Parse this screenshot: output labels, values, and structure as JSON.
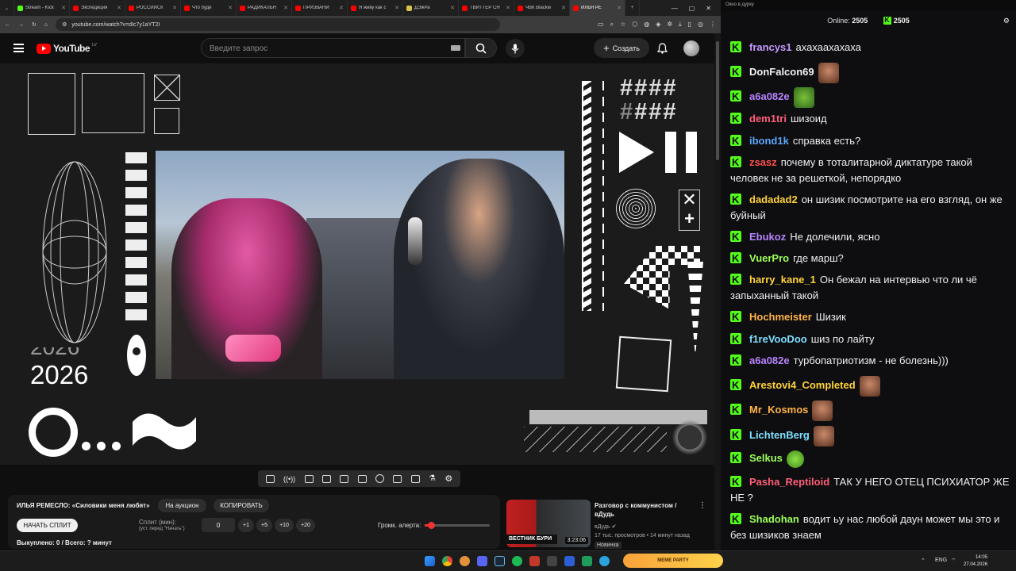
{
  "browser": {
    "tabs": [
      {
        "label": "Stream - Kick",
        "color": "#53fc18"
      },
      {
        "label": "Экспедиция",
        "color": "#ff0000"
      },
      {
        "label": "РОССИЙСК",
        "color": "#ff0000"
      },
      {
        "label": "Что буде",
        "color": "#ff0000"
      },
      {
        "label": "РАДИКАЛЬН",
        "color": "#ff0000"
      },
      {
        "label": "ПРИЗВАНИ",
        "color": "#ff0000"
      },
      {
        "label": "Я живу как с",
        "color": "#ff0000"
      },
      {
        "label": "ДЭжРа",
        "color": "#d8c24a"
      },
      {
        "label": "ТВИТТЕР СН",
        "color": "#ff0000"
      },
      {
        "label": "ЧВК Blackw",
        "color": "#ff0000"
      },
      {
        "label": "ИЛЬЯ РЕ",
        "color": "#ff0000",
        "active": true
      }
    ],
    "url": "youtube.com/watch?v=dIc7y1aYT2I"
  },
  "youtube": {
    "logo_text": "YouTube",
    "region": "LV",
    "search_placeholder": "Введите запрос",
    "create_label": "Создать"
  },
  "video": {
    "overlay_numbers": [
      "2026",
      "2026"
    ]
  },
  "panel": {
    "title": "ИЛЬЯ РЕМЕСЛО: «Силовики меня любят»",
    "auction_label": "На аукцион",
    "copy_label": "КОПИРОВАТЬ",
    "start_split_label": "НАЧАТЬ СПЛИТ",
    "split_label": "Сплит (мин):",
    "split_hint": "(уст. перед \"Начать\")",
    "split_value": "0",
    "steps": [
      "+1",
      "+5",
      "+10",
      "+20"
    ],
    "volume_label": "Громк. алерта:",
    "volume_fraction": 0.1,
    "footer": "Выкуплено: 0 / Всего: ? минут"
  },
  "recommended": {
    "title": "Разговор с коммунистом / вДудь",
    "channel": "вДудь",
    "meta": "17 тыс. просмотров • 14 минут назад",
    "badge": "Новинка",
    "duration": "3:23:06",
    "thumb_text": "ВЕСТНИК БУРИ"
  },
  "chat": {
    "window_title": "Окно в дурку",
    "online_label": "Online:",
    "online_count": "2505",
    "kick_count": "2505",
    "messages": [
      {
        "user": "francys1",
        "color": "#c59bff",
        "text": "ахахаахахаха"
      },
      {
        "user": "DonFalcon69",
        "color": "#f2f2f2",
        "text": "",
        "emote": "face"
      },
      {
        "user": "a6a082e",
        "color": "#b784ff",
        "text": "",
        "emote": "frog"
      },
      {
        "user": "dem1tri",
        "color": "#ff5e7a",
        "text": "шизоид"
      },
      {
        "user": "ibond1k",
        "color": "#5aa9ff",
        "text": "справка есть?"
      },
      {
        "user": "zsasz",
        "color": "#ff4f4f",
        "text": "почему в тоталитарной диктатуре такой человек не за решеткой, непорядко"
      },
      {
        "user": "dadadad2",
        "color": "#ffd23a",
        "text": "он шизик посмотрите на его взгляд, он же буйный"
      },
      {
        "user": "Ebukoz",
        "color": "#b784ff",
        "text": "Не долечили, ясно"
      },
      {
        "user": "VuerPro",
        "color": "#9cff5a",
        "text": "где марш?"
      },
      {
        "user": "harry_kane_1",
        "color": "#ffd23a",
        "text": "Он бежал на интервью что ли чё запыханный такой"
      },
      {
        "user": "Hochmeister",
        "color": "#ffb347",
        "text": "Шизик"
      },
      {
        "user": "f1reVooDoo",
        "color": "#7ee0ff",
        "text": "шиз по лайту"
      },
      {
        "user": "a6a082e",
        "color": "#b784ff",
        "text": "турбопатриотизм - не болезнь)))"
      },
      {
        "user": "Arestovi4_Completed",
        "color": "#ffd23a",
        "text": "",
        "emote": "face"
      },
      {
        "user": "Mr_Kosmos",
        "color": "#ffb347",
        "text": "",
        "emote": "face"
      },
      {
        "user": "LichtenBerg",
        "color": "#7ee0ff",
        "text": "",
        "emote": "face"
      },
      {
        "user": "Selkus",
        "color": "#9cff5a",
        "text": "",
        "emote": "green"
      },
      {
        "user": "Pasha_Reptiloid",
        "color": "#ff5e7a",
        "text": "ТАК У НЕГО ОТЕЦ ПСИХИАТОР ЖЕ НЕ ?"
      },
      {
        "user": "Shadohan",
        "color": "#9cff5a",
        "text": "водит ьу нас любой даун может мы это и без шизиков знаем"
      }
    ]
  },
  "taskbar": {
    "meme_party": "MEME PARTY",
    "lang": "ENG",
    "time": "14:05",
    "date": "27.04.2026"
  }
}
